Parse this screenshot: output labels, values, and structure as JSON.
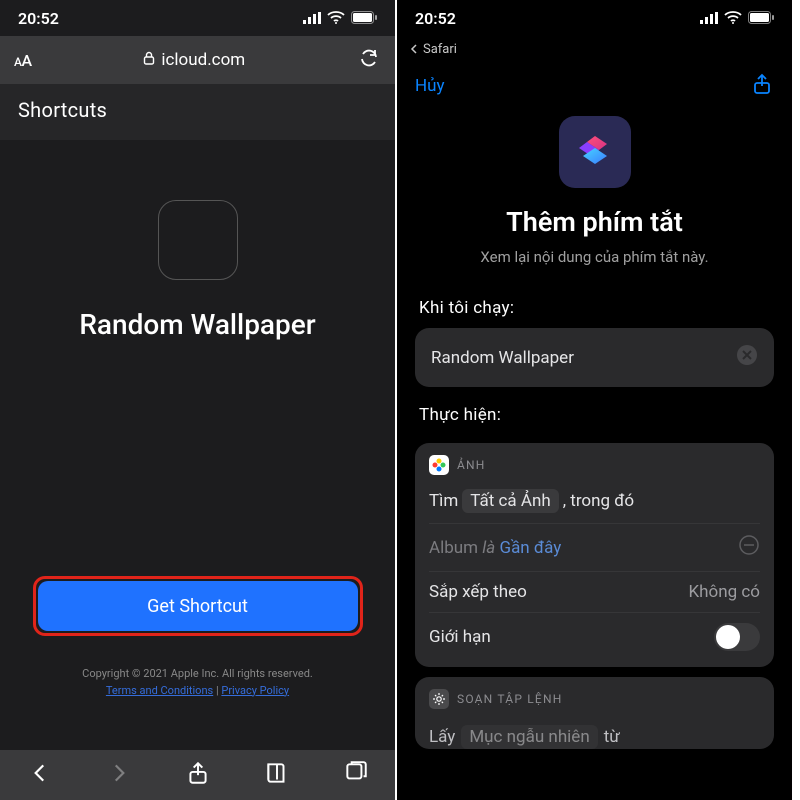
{
  "status": {
    "time": "20:52"
  },
  "left": {
    "addr_text": "icloud.com",
    "aA_small": "A",
    "aA_large": "A",
    "site_header": "Shortcuts",
    "hero_title": "Random Wallpaper",
    "get_btn": "Get Shortcut",
    "copyright": "Copyright © 2021 Apple Inc. All rights reserved.",
    "terms": "Terms and Conditions",
    "sep": " | ",
    "privacy": "Privacy Policy"
  },
  "right": {
    "back_app": "Safari",
    "cancel": "Hủy",
    "title": "Thêm phím tắt",
    "subtitle": "Xem lại nội dung của phím tắt này.",
    "when_run": "Khi tôi chạy:",
    "run_name": "Random Wallpaper",
    "do_lbl": "Thực hiện:",
    "card1": {
      "app": "ẢNH",
      "find": "Tìm",
      "all_photos": "Tất cả Ảnh",
      "in_which": ", trong đó",
      "album": "Album",
      "is": "là",
      "recent": "Gần đây",
      "sort_by": "Sắp xếp theo",
      "none": "Không có",
      "limit": "Giới hạn"
    },
    "card2": {
      "app": "SOẠN TẬP LỆNH",
      "get": "Lấy",
      "random_item": "Mục ngẫu nhiên",
      "from": "từ"
    }
  }
}
